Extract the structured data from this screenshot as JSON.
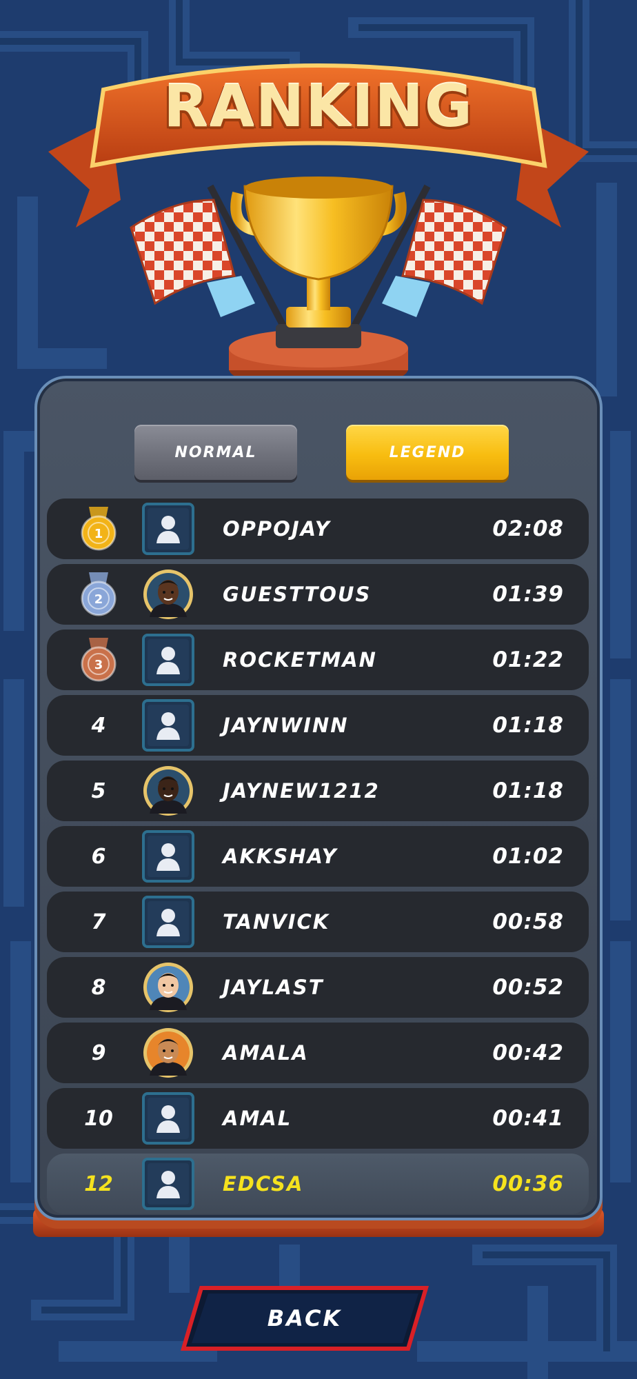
{
  "header": {
    "title": "RANKING"
  },
  "tabs": [
    {
      "label": "NORMAL",
      "active": false
    },
    {
      "label": "LEGEND",
      "active": true
    }
  ],
  "leaderboard": [
    {
      "rank": "1",
      "badge": "gold-medal",
      "avatar": "default-avatar",
      "name": "OPPOJAY",
      "time": "02:08"
    },
    {
      "rank": "2",
      "badge": "silver-medal",
      "avatar": "character-avatar",
      "name": "GUESTTOUS",
      "time": "01:39"
    },
    {
      "rank": "3",
      "badge": "bronze-medal",
      "avatar": "default-avatar",
      "name": "ROCKETMAN",
      "time": "01:22"
    },
    {
      "rank": "4",
      "avatar": "default-avatar",
      "name": "JAYNWINN",
      "time": "01:18"
    },
    {
      "rank": "5",
      "avatar": "character-avatar",
      "name": "JAYNEW1212",
      "time": "01:18"
    },
    {
      "rank": "6",
      "avatar": "default-avatar",
      "name": "AKKSHAY",
      "time": "01:02"
    },
    {
      "rank": "7",
      "avatar": "default-avatar",
      "name": "TANVICK",
      "time": "00:58"
    },
    {
      "rank": "8",
      "avatar": "character-avatar",
      "name": "JAYLAST",
      "time": "00:52"
    },
    {
      "rank": "9",
      "avatar": "character-avatar",
      "name": "AMALA",
      "time": "00:42"
    },
    {
      "rank": "10",
      "avatar": "default-avatar",
      "name": "AMAL",
      "time": "00:41"
    }
  ],
  "current_player": {
    "rank": "12",
    "avatar": "default-avatar",
    "name": "EDCSA",
    "time": "00:36"
  },
  "footer": {
    "back_label": "BACK"
  },
  "colors": {
    "active_tab": "#f8bd10",
    "inactive_tab": "#6f717b",
    "highlight_text": "#f5e21e",
    "gold": "#f2b318",
    "silver": "#8aa6d8",
    "bronze": "#c9714a"
  }
}
